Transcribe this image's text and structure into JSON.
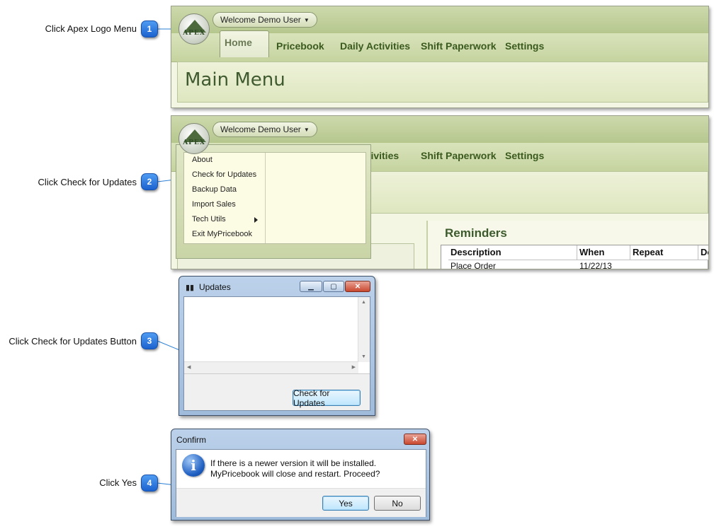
{
  "callouts": [
    {
      "number": "1",
      "label": "Click Apex Logo Menu"
    },
    {
      "number": "2",
      "label": "Click Check for Updates"
    },
    {
      "number": "3",
      "label": "Click Check for Updates Button"
    },
    {
      "number": "4",
      "label": "Click Yes"
    }
  ],
  "accent_color": "#1c62cf",
  "app": {
    "welcome": "Welcome Demo User",
    "logo_text": "APEX",
    "tabs": [
      "Home",
      "Pricebook",
      "Daily Activities",
      "Shift Paperwork",
      "Settings"
    ],
    "tab_partial": "ctivities",
    "main_title": "Main Menu"
  },
  "logo_menu": {
    "items": [
      "About",
      "Check for Updates",
      "Backup Data",
      "Import Sales",
      "Tech Utils",
      "Exit MyPricebook"
    ]
  },
  "reminders": {
    "title": "Reminders",
    "columns": [
      "Description",
      "When",
      "Repeat",
      "Do"
    ],
    "rows": [
      [
        "Place Order",
        "11/22/13",
        "",
        ""
      ]
    ]
  },
  "updates_dialog": {
    "title": "Updates",
    "button": "Check for Updates"
  },
  "confirm_dialog": {
    "title": "Confirm",
    "line1": "If there is a newer version it will be installed.",
    "line2": "MyPricebook will close and restart. Proceed?",
    "yes": "Yes",
    "no": "No"
  }
}
